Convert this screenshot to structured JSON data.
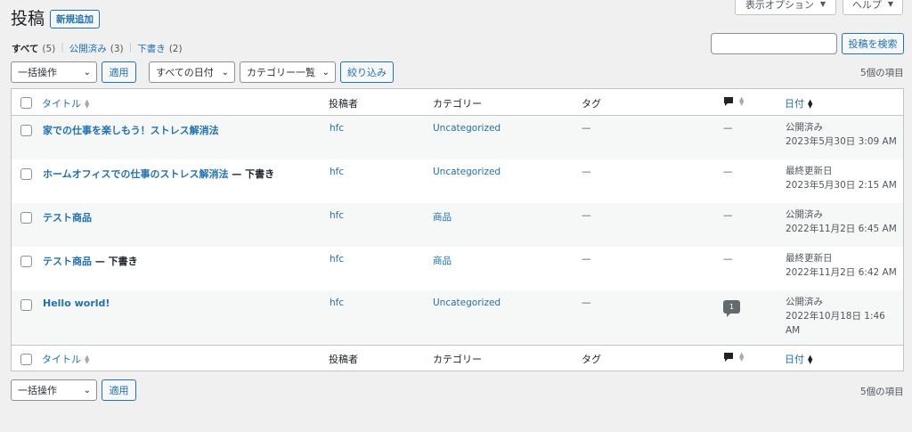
{
  "top_buttons": {
    "screen_options": "表示オプション",
    "help": "ヘルプ"
  },
  "title": "投稿",
  "add_new": "新規追加",
  "views": [
    {
      "label": "すべて",
      "count": "(5)",
      "current": true
    },
    {
      "label": "公開済み",
      "count": "(3)",
      "current": false
    },
    {
      "label": "下書き",
      "count": "(2)",
      "current": false
    }
  ],
  "views_sep": "|",
  "search": {
    "value": "",
    "button": "投稿を検索"
  },
  "filters": {
    "bulk": "一括操作",
    "apply": "適用",
    "date": "すべての日付",
    "category": "カテゴリー一覧",
    "filter": "絞り込み"
  },
  "item_count": "5個の項目",
  "columns": {
    "title": "タイトル",
    "author": "投稿者",
    "categories": "カテゴリー",
    "tags": "タグ",
    "date": "日付"
  },
  "sort_icons": {
    "updown": "▲▼",
    "down": "▲▼"
  },
  "rows": [
    {
      "title": "家での仕事を楽しもう！ストレス解消法",
      "state": "",
      "author": "hfc",
      "category": "Uncategorized",
      "tags": "—",
      "comments": "—",
      "date_status": "公開済み",
      "date_value": "2023年5月30日 3:09 AM",
      "date_value2": ""
    },
    {
      "title": "ホームオフィスでの仕事のストレス解消法",
      "state": " — 下書き",
      "author": "hfc",
      "category": "Uncategorized",
      "tags": "—",
      "comments": "—",
      "date_status": "最終更新日",
      "date_value": "2023年5月30日 2:15 AM",
      "date_value2": ""
    },
    {
      "title": "テスト商品",
      "state": "",
      "author": "hfc",
      "category": "商品",
      "tags": "—",
      "comments": "—",
      "date_status": "公開済み",
      "date_value": "2022年11月2日 6:45 AM",
      "date_value2": ""
    },
    {
      "title": "テスト商品",
      "state": " — 下書き",
      "author": "hfc",
      "category": "商品",
      "tags": "—",
      "comments": "—",
      "date_status": "最終更新日",
      "date_value": "2022年11月2日 6:42 AM",
      "date_value2": ""
    },
    {
      "title": "Hello world!",
      "state": "",
      "author": "hfc",
      "category": "Uncategorized",
      "tags": "—",
      "comments": "1",
      "date_status": "公開済み",
      "date_value": "2022年10月18日 1:46",
      "date_value2": "AM"
    }
  ],
  "colors": {
    "link": "#2271b1",
    "bg": "#f0f0f1",
    "border": "#c3c4c7"
  },
  "icons": {
    "comment": "comment-icon",
    "checkbox": "checkbox"
  }
}
